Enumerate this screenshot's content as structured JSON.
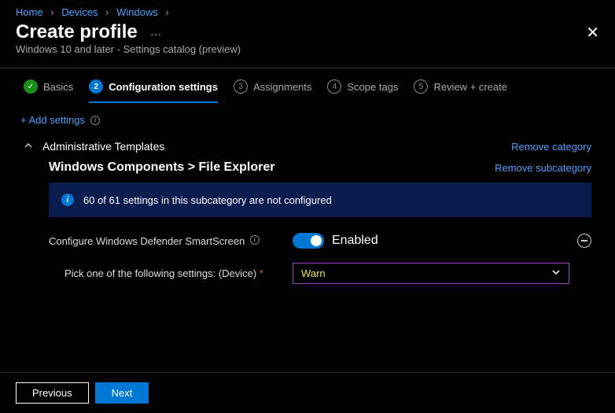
{
  "breadcrumbs": [
    "Home",
    "Devices",
    "Windows"
  ],
  "header": {
    "title": "Create profile",
    "subtitle": "Windows 10 and later - Settings catalog (preview)"
  },
  "tabs": [
    {
      "num": "✓",
      "label": "Basics",
      "state": "done"
    },
    {
      "num": "2",
      "label": "Configuration settings",
      "state": "active"
    },
    {
      "num": "3",
      "label": "Assignments",
      "state": ""
    },
    {
      "num": "4",
      "label": "Scope tags",
      "state": ""
    },
    {
      "num": "5",
      "label": "Review + create",
      "state": ""
    }
  ],
  "addSettingsLabel": "+ Add settings",
  "category": {
    "name": "Administrative Templates",
    "removeLabel": "Remove category"
  },
  "subcategory": {
    "name": "Windows Components > File Explorer",
    "removeLabel": "Remove subcategory"
  },
  "banner": "60 of 61 settings in this subcategory are not configured",
  "setting": {
    "label": "Configure Windows Defender SmartScreen",
    "state": "Enabled"
  },
  "picker": {
    "label": "Pick one of the following settings: (Device)",
    "required": "*",
    "value": "Warn"
  },
  "footer": {
    "prev": "Previous",
    "next": "Next"
  }
}
